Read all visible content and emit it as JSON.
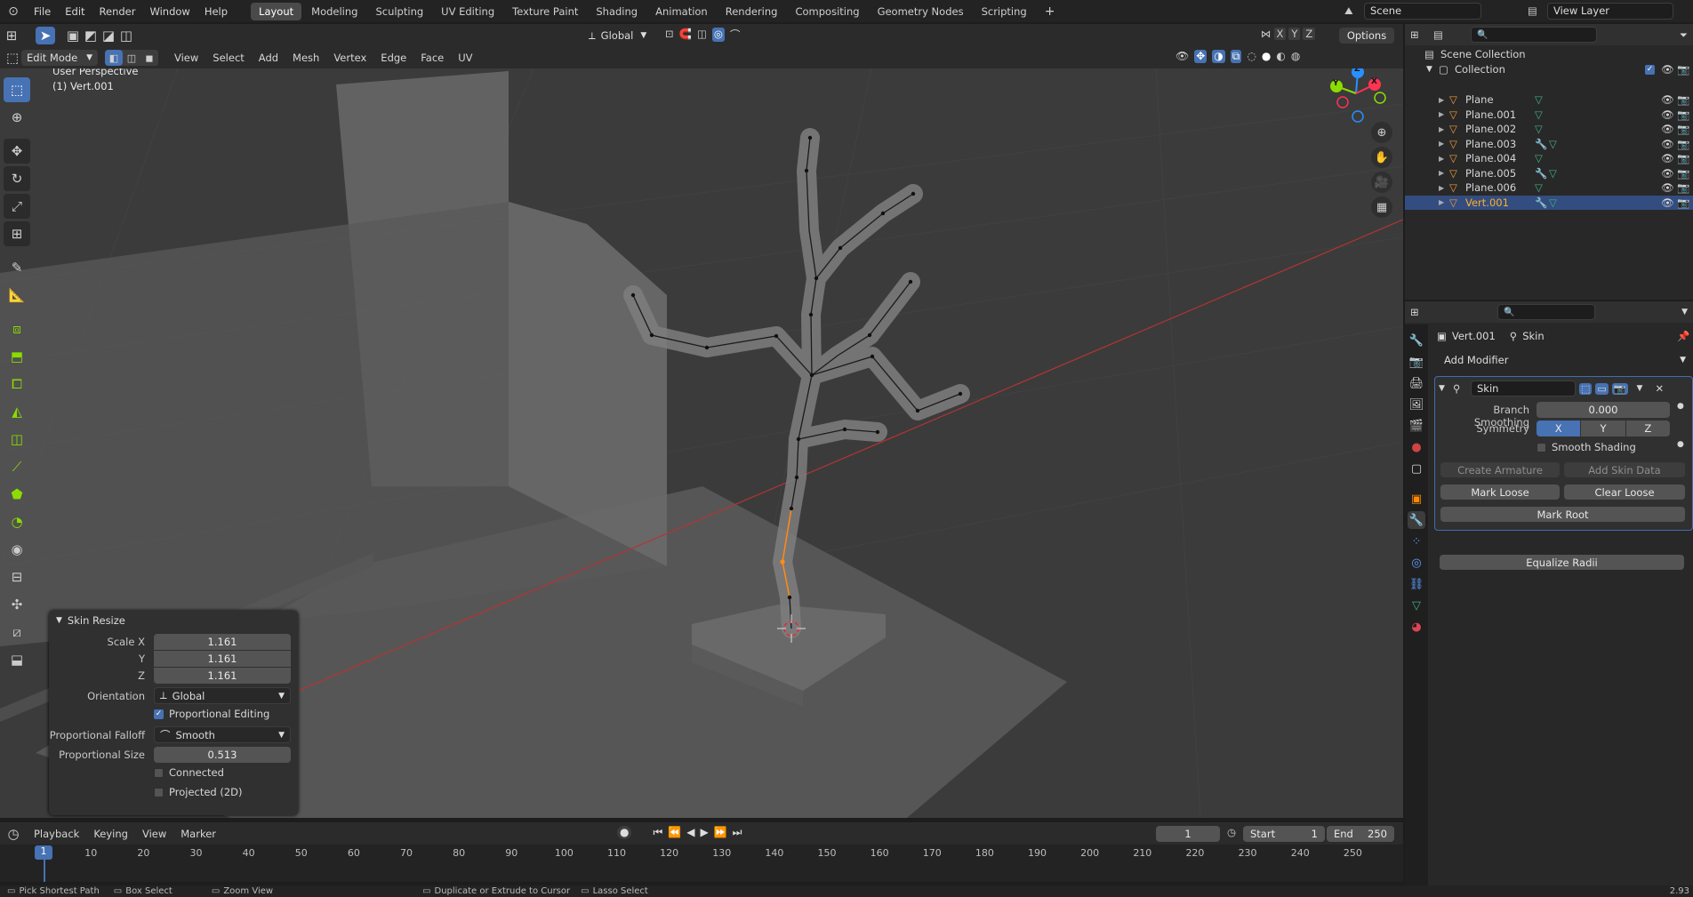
{
  "top_menu": [
    "File",
    "Edit",
    "Render",
    "Window",
    "Help"
  ],
  "workspaces": [
    {
      "label": "Layout",
      "active": true
    },
    {
      "label": "Modeling",
      "active": false
    },
    {
      "label": "Sculpting",
      "active": false
    },
    {
      "label": "UV Editing",
      "active": false
    },
    {
      "label": "Texture Paint",
      "active": false
    },
    {
      "label": "Shading",
      "active": false
    },
    {
      "label": "Animation",
      "active": false
    },
    {
      "label": "Rendering",
      "active": false
    },
    {
      "label": "Compositing",
      "active": false
    },
    {
      "label": "Geometry Nodes",
      "active": false
    },
    {
      "label": "Scripting",
      "active": false
    }
  ],
  "scene_field": "Scene",
  "view_layer_field": "View Layer",
  "viewport_header": {
    "mode": "Edit Mode",
    "menus": [
      "View",
      "Select",
      "Add",
      "Mesh",
      "Vertex",
      "Edge",
      "Face",
      "UV"
    ],
    "transform_orientation": "Global",
    "axes": [
      "X",
      "Y",
      "Z"
    ],
    "options": "Options"
  },
  "viewport_overlay": {
    "perspective": "User Perspective",
    "object": "(1) Vert.001"
  },
  "gizmo": {
    "z": "Z",
    "y": "Y",
    "x": "X"
  },
  "operator_panel": {
    "title": "Skin Resize",
    "scale_x_label": "Scale X",
    "scale_x": "1.161",
    "y_label": "Y",
    "y": "1.161",
    "z_label": "Z",
    "z": "1.161",
    "orientation_label": "Orientation",
    "orientation": "Global",
    "proportional_editing": "Proportional Editing",
    "proportional_editing_checked": true,
    "falloff_label": "Proportional Falloff",
    "falloff": "Smooth",
    "size_label": "Proportional Size",
    "size": "0.513",
    "connected": "Connected",
    "projected": "Projected (2D)"
  },
  "outliner": {
    "scene_collection": "Scene Collection",
    "collection": "Collection",
    "items": [
      {
        "name": "Plane",
        "modifier": false,
        "selected": false
      },
      {
        "name": "Plane.001",
        "modifier": false,
        "selected": false
      },
      {
        "name": "Plane.002",
        "modifier": false,
        "selected": false
      },
      {
        "name": "Plane.003",
        "modifier": true,
        "selected": false
      },
      {
        "name": "Plane.004",
        "modifier": false,
        "selected": false
      },
      {
        "name": "Plane.005",
        "modifier": true,
        "selected": false
      },
      {
        "name": "Plane.006",
        "modifier": false,
        "selected": false
      },
      {
        "name": "Vert.001",
        "modifier": true,
        "selected": true
      }
    ]
  },
  "properties": {
    "breadcrumb_object": "Vert.001",
    "breadcrumb_modifier": "Skin",
    "add_modifier": "Add Modifier",
    "modifier_name": "Skin",
    "branch_smoothing_label": "Branch Smoothing",
    "branch_smoothing": "0.000",
    "symmetry_label": "Symmetry",
    "symmetry": [
      "X",
      "Y",
      "Z"
    ],
    "smooth_shading": "Smooth Shading",
    "create_armature": "Create Armature",
    "add_skin_data": "Add Skin Data",
    "mark_loose": "Mark Loose",
    "clear_loose": "Clear Loose",
    "mark_root": "Mark Root",
    "equalize_radii": "Equalize Radii"
  },
  "timeline": {
    "menus": [
      "Playback",
      "Keying",
      "View",
      "Marker"
    ],
    "current_frame": "1",
    "start_label": "Start",
    "start": "1",
    "end_label": "End",
    "end": "250",
    "ticks": [
      "10",
      "20",
      "30",
      "40",
      "50",
      "60",
      "70",
      "80",
      "90",
      "100",
      "110",
      "120",
      "130",
      "140",
      "150",
      "160",
      "170",
      "180",
      "190",
      "200",
      "210",
      "220",
      "230",
      "240",
      "250"
    ],
    "playhead": "1"
  },
  "status_bar": {
    "left1": "Pick Shortest Path",
    "left2": "Box Select",
    "left3": "Zoom View",
    "mid1": "Duplicate or Extrude to Cursor",
    "mid2": "Lasso Select",
    "version": "2.93"
  },
  "colors": {
    "accent": "#4772b3",
    "selected_object": "#ffaf29",
    "x_axis": "#ff3352",
    "y_axis": "#8bdc00",
    "z_axis": "#2890ff"
  }
}
